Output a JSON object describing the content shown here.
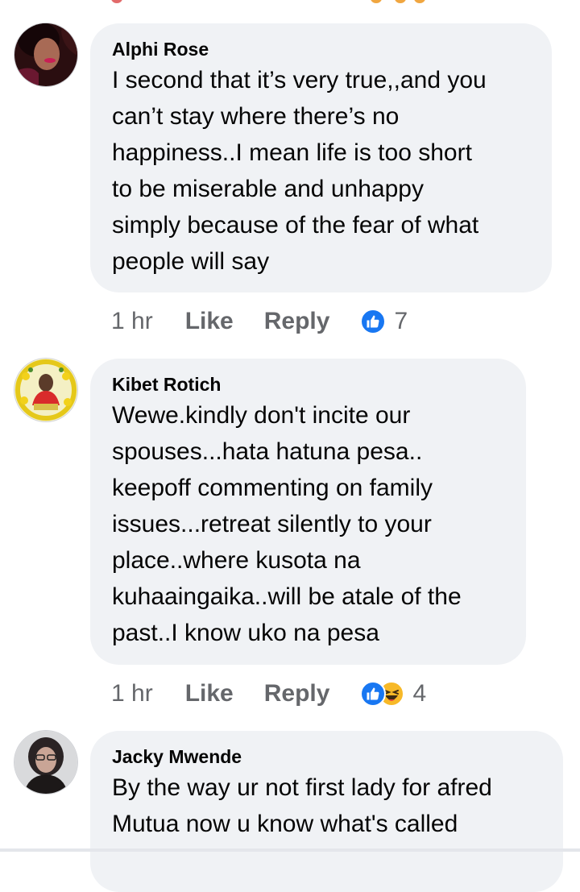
{
  "comments": [
    {
      "author": "Alphi Rose",
      "lines": [
        "I second that it’s very true,,and you",
        "can’t stay where there’s no",
        "happiness..I mean life is too short",
        "to be miserable and unhappy",
        "simply because of the fear of what",
        "people will say"
      ],
      "time": "1 hr",
      "like_label": "Like",
      "reply_label": "Reply",
      "reactions": [
        "like-icon"
      ],
      "reaction_count": "7"
    },
    {
      "author": "Kibet Rotich",
      "lines": [
        "Wewe.kindly don't incite our",
        "spouses...hata hatuna pesa..",
        "keepoff commenting on family",
        "issues...retreat silently to your",
        "place..where kusota na",
        "kuhaaingaika..will be atale of the",
        "past..I know uko na pesa"
      ],
      "time": "1 hr",
      "like_label": "Like",
      "reply_label": "Reply",
      "reactions": [
        "like-icon",
        "haha-icon"
      ],
      "reaction_count": "4"
    },
    {
      "author": "Jacky Mwende",
      "lines": [
        "By the way ur not first lady for afred",
        "Mutua now u know  what's called"
      ]
    }
  ],
  "colors": {
    "bubble": "#f0f2f5",
    "meta_text": "#65676b",
    "like_blue": "#1877f2",
    "haha_yellow": "#f7b928"
  }
}
